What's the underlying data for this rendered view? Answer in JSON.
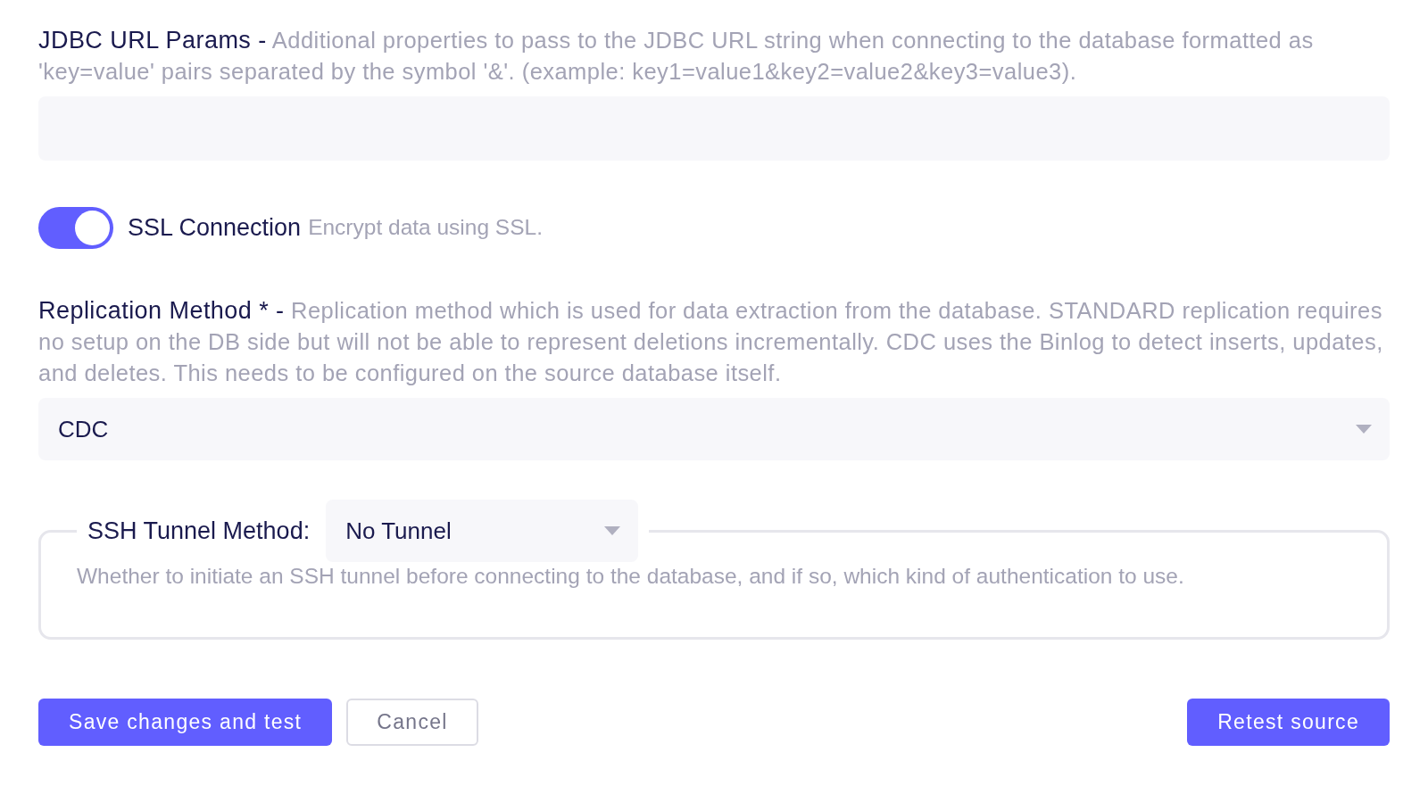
{
  "jdbc_url_params": {
    "label": "JDBC URL Params -",
    "description": "Additional properties to pass to the JDBC URL string when connecting to the database formatted as 'key=value' pairs separated by the symbol '&'. (example: key1=value1&key2=value2&key3=value3)."
  },
  "ssl_connection": {
    "label": "SSL Connection",
    "description": "Encrypt data using SSL.",
    "on": true
  },
  "replication_method": {
    "label": "Replication Method * -",
    "description": "Replication method which is used for data extraction from the database. STANDARD replication requires no setup on the DB side but will not be able to represent deletions incrementally. CDC uses the Binlog to detect inserts, updates, and deletes. This needs to be configured on the source database itself.",
    "value": "CDC"
  },
  "ssh_tunnel_method": {
    "label": "SSH Tunnel Method:",
    "value": "No Tunnel",
    "description": "Whether to initiate an SSH tunnel before connecting to the database, and if so, which kind of authentication to use."
  },
  "actions": {
    "left": [
      {
        "label": "Save changes and test",
        "kind": "primary"
      },
      {
        "label": "Cancel",
        "kind": "outline"
      }
    ],
    "right": [
      {
        "label": "Retest source",
        "kind": "primary"
      }
    ]
  }
}
